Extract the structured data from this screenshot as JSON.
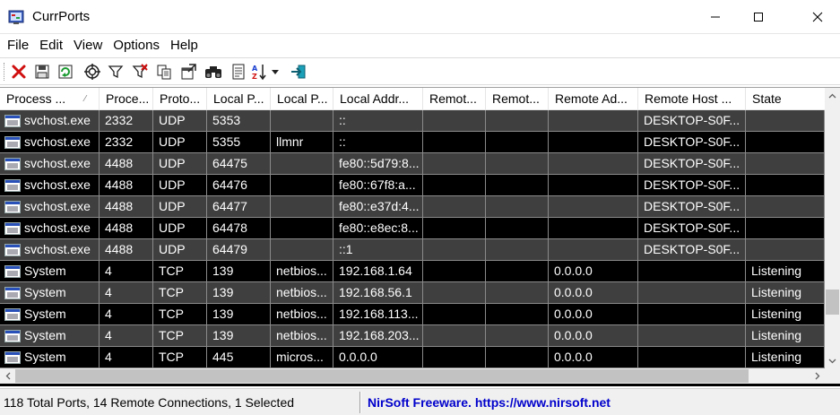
{
  "window": {
    "title": "CurrPorts"
  },
  "menu": [
    "File",
    "Edit",
    "View",
    "Options",
    "Help"
  ],
  "toolbar_icons": [
    "close-connection-icon",
    "save-icon",
    "refresh-icon",
    "properties-target-icon",
    "filter-icon",
    "remove-filter-icon",
    "copy-icon",
    "html-report-icon",
    "find-icon",
    "text-report-icon",
    "sort-icon",
    "sort-dropdown-icon",
    "exit-icon"
  ],
  "columns": [
    "Process ...",
    "Proce...",
    "Proto...",
    "Local P...",
    "Local P...",
    "Local Addr...",
    "Remot...",
    "Remot...",
    "Remote Ad...",
    "Remote Host ...",
    "State"
  ],
  "rows": [
    [
      "svchost.exe",
      "2332",
      "UDP",
      "5353",
      "",
      "::",
      "",
      "",
      "",
      "DESKTOP-S0F...",
      ""
    ],
    [
      "svchost.exe",
      "2332",
      "UDP",
      "5355",
      "llmnr",
      "::",
      "",
      "",
      "",
      "DESKTOP-S0F...",
      ""
    ],
    [
      "svchost.exe",
      "4488",
      "UDP",
      "64475",
      "",
      "fe80::5d79:8...",
      "",
      "",
      "",
      "DESKTOP-S0F...",
      ""
    ],
    [
      "svchost.exe",
      "4488",
      "UDP",
      "64476",
      "",
      "fe80::67f8:a...",
      "",
      "",
      "",
      "DESKTOP-S0F...",
      ""
    ],
    [
      "svchost.exe",
      "4488",
      "UDP",
      "64477",
      "",
      "fe80::e37d:4...",
      "",
      "",
      "",
      "DESKTOP-S0F...",
      ""
    ],
    [
      "svchost.exe",
      "4488",
      "UDP",
      "64478",
      "",
      "fe80::e8ec:8...",
      "",
      "",
      "",
      "DESKTOP-S0F...",
      ""
    ],
    [
      "svchost.exe",
      "4488",
      "UDP",
      "64479",
      "",
      "::1",
      "",
      "",
      "",
      "DESKTOP-S0F...",
      ""
    ],
    [
      "System",
      "4",
      "TCP",
      "139",
      "netbios...",
      "192.168.1.64",
      "",
      "",
      "0.0.0.0",
      "",
      "Listening"
    ],
    [
      "System",
      "4",
      "TCP",
      "139",
      "netbios...",
      "192.168.56.1",
      "",
      "",
      "0.0.0.0",
      "",
      "Listening"
    ],
    [
      "System",
      "4",
      "TCP",
      "139",
      "netbios...",
      "192.168.113...",
      "",
      "",
      "0.0.0.0",
      "",
      "Listening"
    ],
    [
      "System",
      "4",
      "TCP",
      "139",
      "netbios...",
      "192.168.203...",
      "",
      "",
      "0.0.0.0",
      "",
      "Listening"
    ],
    [
      "System",
      "4",
      "TCP",
      "445",
      "micros...",
      "0.0.0.0",
      "",
      "",
      "0.0.0.0",
      "",
      "Listening"
    ]
  ],
  "status": {
    "summary": "118 Total Ports, 14 Remote Connections, 1 Selected",
    "link": "NirSoft Freeware. https://www.nirsoft.net"
  },
  "colors": {
    "row_alt": "#3f3f3f",
    "row_even": "#000000",
    "row_text": "#ffffff",
    "link": "#0000cc"
  }
}
